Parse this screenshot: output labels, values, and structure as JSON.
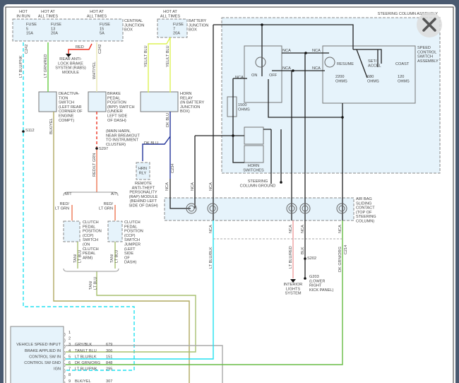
{
  "colors": {
    "lt_blu_pnk": "#22e0f0",
    "lt_grn_red": "#66cc44",
    "wht_yel": "#f2f0c0",
    "red": "#ee3322",
    "yel_lt_blu": "#ddf255",
    "dk_blu": "#223399",
    "blk_yel": "#b0a860",
    "red_lt_grn": "#ee7755",
    "tan_lt_blu": "#a8c070",
    "dk_grn_org": "#66bb44",
    "gry_blk": "#aaaaaa",
    "lt_blu_blk": "#22e0f0",
    "lt_blu_red": "#f0a0a0",
    "box_fill": "#e6f3fb"
  },
  "labels": {
    "hot_in_run": [
      "HOT",
      "IN RUN"
    ],
    "hot_at_all_times": [
      "HOT AT",
      "ALL TIMES"
    ],
    "fuse5": [
      "FUSE",
      "5",
      "15A"
    ],
    "fuse13": [
      "FUSE",
      "13",
      "20A"
    ],
    "fuse15": [
      "FUSE",
      "15",
      "5A"
    ],
    "fuse7": [
      "FUSE",
      "7",
      "20A"
    ],
    "central_jb": [
      "CENTRAL",
      "JUNCTION",
      "BOX"
    ],
    "battery_jb": [
      "BATTERY",
      "JUNCTION",
      "BOX"
    ],
    "rabs": [
      "REAR ANTI-",
      "LOCK BRAKE",
      "SYSTEM (RABS)",
      "MODULE"
    ],
    "deactivation": [
      "DEACTIVA-",
      "TION",
      "SWITCH",
      "(LEFT REAR",
      "CORNER OF",
      "ENGINE",
      "COMPT)"
    ],
    "bpp": [
      "BRAKE",
      "PEDAL",
      "POSITION",
      "(BPP) SWITCH",
      "(UNDER",
      "LEFT SIDE",
      "OF DASH)"
    ],
    "horn_relay": [
      "HORN",
      "RELAY",
      "(IN BATTERY",
      "JUNCTION",
      "BOX)"
    ],
    "main_harn": [
      "(MAIN HARN,",
      "NEAR BREAKOUT",
      "TO INSTRUMENT",
      "CLUSTER)"
    ],
    "rap": [
      "REMOTE",
      "ANTI-THEFT",
      "PERSONALITY",
      "(RAP) MODULE",
      "(BEHIND LEFT",
      "SIDE OF DASH)"
    ],
    "hrn_rly": [
      "HRN",
      "RLY"
    ],
    "ccp_switch": [
      "CLUTCH",
      "PEDAL",
      "POSITION",
      "(CCP)",
      "SWITCH",
      "(ON",
      "CLUTCH",
      "PEDAL",
      "ARM)"
    ],
    "ccp_jumper": [
      "CLUTCH",
      "PEDAL",
      "POSITION",
      "(CCP)",
      "SWITCH",
      "JUMPER",
      "(LEFT",
      "SIDE",
      "OF",
      "DASH)"
    ],
    "red_lt_grn": [
      "RED/",
      "LT GRN"
    ],
    "steering_column_assembly": "STEERING COLUMN ASSEMBLY",
    "speed_control": [
      "SPEED",
      "CONTROL",
      "SWITCH",
      "ASSEMBLY"
    ],
    "resume": "RESUME",
    "set_accel": [
      "SET/",
      "ACCEL"
    ],
    "coast": "COAST",
    "ohms2200": [
      "2200",
      "OHMS"
    ],
    "ohms680": [
      "680",
      "OHMS"
    ],
    "ohms120": [
      "120",
      "OHMS"
    ],
    "ohms1500": [
      "1500",
      "OHMS"
    ],
    "on": "ON",
    "off": "OFF",
    "nca": "NCA",
    "horn_switches": [
      "HORN",
      "SWITCHES"
    ],
    "steering_ground": [
      "STEERING",
      "COLUMN GROUND"
    ],
    "air_bag": [
      "AIR BAG",
      "SLIDING",
      "CONTACT",
      "(TOP OF",
      "STEERING",
      "COLUMN)"
    ],
    "interior_lights": [
      "INTERIOR",
      "LIGHTS",
      "SYSTEM"
    ],
    "g203": [
      "G203",
      "(LOWER",
      "RIGHT",
      "KICK PANEL)"
    ],
    "s112": "S112",
    "s297": "S297",
    "s202": "S202",
    "mt": "M/T",
    "at": "A/T"
  },
  "wires": {
    "lt_blu_pnk": "LT BLU/PNK",
    "lt_grn_red": "LT GRN/RED",
    "wht_yel": "WHT/YEL",
    "red": "RED",
    "yel_lt_blu": "YEL/LT BLU",
    "blk_yel": "BLK/YEL",
    "red_lt_grn": "RED/LT GRN",
    "dk_blu": "DK BLU",
    "dk_blu2": [
      "DK",
      "BLU"
    ],
    "tan_lt_blu": [
      "TAN/",
      "LT BLU"
    ],
    "lt_blu_blk": "LT BLU/BLK",
    "lt_blu_red": "LT BLU/RED",
    "blk": "BLK",
    "dk_grn_org": "DK GRN/ORG"
  },
  "connectors": {
    "c242": "C242",
    "c234": "C234",
    "c214": "C214",
    "pin15": "15",
    "pin2": "2",
    "pin25": "25",
    "pin3": "3",
    "pin1": "1",
    "pin2r": "2",
    "pin20": "20",
    "pin4": "4"
  },
  "module": {
    "pins": [
      {
        "num": "1",
        "label": "",
        "wire": "",
        "circuit": ""
      },
      {
        "num": "2",
        "label": "",
        "wire": "",
        "circuit": ""
      },
      {
        "num": "3",
        "label": "VEHICLE SPEED INPUT",
        "wire": "GRY/BLK",
        "circuit": "679"
      },
      {
        "num": "4",
        "label": "BRAKE APPLIED IN",
        "wire": "TAN/LT BLU",
        "circuit": "306"
      },
      {
        "num": "5",
        "label": "CONTROL SW IN",
        "wire": "LT BLU/BLK",
        "circuit": "151"
      },
      {
        "num": "6",
        "label": "CONTROL SW GND",
        "wire": "DK GRN/ORG",
        "circuit": "848"
      },
      {
        "num": "7",
        "label": "IGN",
        "wire": "LT BLU/PNK",
        "circuit": "295"
      },
      {
        "num": "8",
        "label": "",
        "wire": "",
        "circuit": ""
      },
      {
        "num": "9",
        "label": "",
        "wire": "BLK/YEL",
        "circuit": "307"
      }
    ]
  },
  "close_icon": "close-icon"
}
